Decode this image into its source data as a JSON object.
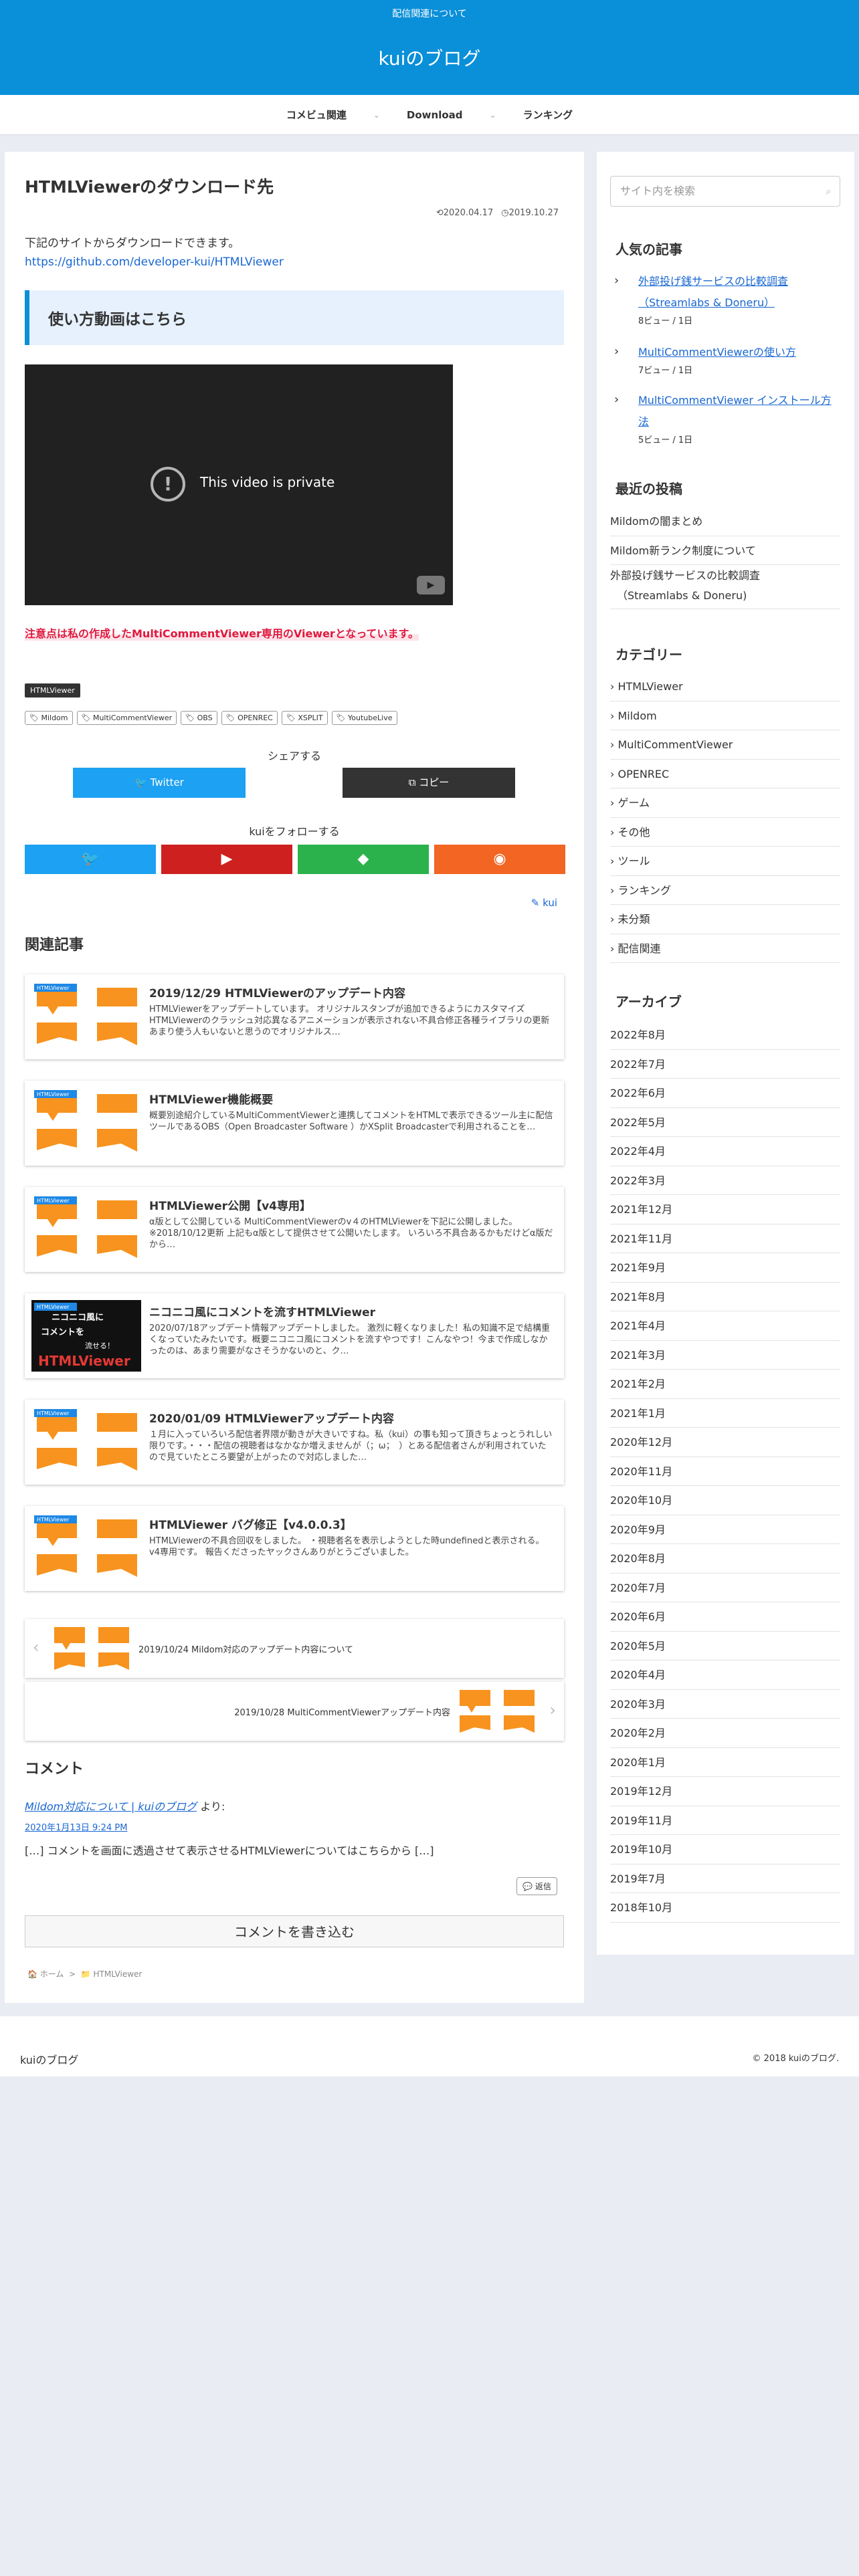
{
  "header": {
    "tagline": "配信関連について",
    "site_title": "kuiのブログ"
  },
  "nav": [
    {
      "label": "コメビュ関連"
    },
    {
      "label": "Download"
    },
    {
      "label": "ランキング"
    }
  ],
  "post": {
    "title": "HTMLViewerのダウンロード先",
    "published": "2020.04.17",
    "updated": "2019.10.27",
    "intro": "下記のサイトからダウンロードできます。",
    "link": "https://github.com/developer-kui/HTMLViewer",
    "h2": "使い方動画はこちら",
    "video_message": "This video is private",
    "note": "注意点は私の作成したMultiCommentViewer専用のViewerとなっています。",
    "category": "HTMLViewer",
    "tags": [
      "Mildom",
      "MultiCommentViewer",
      "OBS",
      "OPENREC",
      "XSPLIT",
      "YoutubeLive"
    ],
    "share_heading": "シェアする",
    "share_twitter": "Twitter",
    "share_copy": "コピー",
    "follow_heading": "kuiをフォローする",
    "author": "kui"
  },
  "related": {
    "heading": "関連記事",
    "items": [
      {
        "badge": "HTMLViewer",
        "title": "2019/12/29 HTMLViewerのアップデート内容",
        "snippet": "HTMLViewerをアップデートしています。 オリジナルスタンプが追加できるようにカスタマイズHTMLViewerのクラッシュ対応異なるアニメーションが表示されない不具合修正各種ライブラリの更新あまり使う人もいないと思うのでオリジナルス…"
      },
      {
        "badge": "HTMLViewer",
        "title": "HTMLViewer機能概要",
        "snippet": "概要別途紹介しているMultiCommentViewerと連携してコメントをHTMLで表示できるツール主に配信ツールであるOBS（Open Broadcaster Software ）かXSplit Broadcasterで利用されることを…"
      },
      {
        "badge": "HTMLViewer",
        "title": "HTMLViewer公開【v4専用】",
        "snippet": "α版として公開している MultiCommentViewerのv４のHTMLViewerを下記に公開しました。 ※2018/10/12更新 上記もα版として提供させて公開いたします。 いろいろ不具合あるかもだけどα版だから…"
      },
      {
        "badge": "HTMLViewer",
        "title": "ニコニコ風にコメントを流すHTMLViewer",
        "snippet": "2020/07/18アップデート情報アップデートしました。 激烈に軽くなりました！私の知識不足で結構重くなっていたみたいです。概要ニコニコ風にコメントを流すやつです！こんなやつ！今まで作成しなかったのは、あまり需要がなさそうかないのと、ク…",
        "thumb_text": [
          "ニコニコ風に",
          "コメントを",
          "流せる！",
          "HTMLViewer"
        ]
      },
      {
        "badge": "HTMLViewer",
        "title": "2020/01/09 HTMLViewerアップデート内容",
        "snippet": "１月に入っていろいろ配信者界隈が動きが大きいですね。私（kui）の事も知って頂きちょっとうれしい限りです。・・・配信の視聴者はなかなか増えませんが（；ω；　）とある配信者さんが利用されていたので見ていたところ要望が上がったので対応しました…"
      },
      {
        "badge": "HTMLViewer",
        "title": "HTMLViewer バグ修正【v4.0.0.3】",
        "snippet": "HTMLViewerの不具合回収をしました。 ・視聴者名を表示しようとした時undefinedと表示される。 v4専用です。 報告くださったヤックさんありがとうございました。"
      }
    ]
  },
  "post_nav": {
    "prev": "2019/10/24 Mildom対応のアップデート内容について",
    "next": "2019/10/28 MultiCommentViewerアップデート内容"
  },
  "comments": {
    "heading": "コメント",
    "author": "Mildom対応について | kuiのブログ",
    "author_suffix": "より:",
    "date": "2020年1月13日 9:24 PM",
    "body": "[…] コメントを画面に透過させて表示させるHTMLViewerについてはこちらから […]",
    "reply": "返信",
    "write": "コメントを書き込む"
  },
  "breadcrumb": {
    "home": "ホーム",
    "category": "HTMLViewer"
  },
  "sidebar": {
    "search_placeholder": "サイト内を検索",
    "popular_heading": "人気の記事",
    "popular": [
      {
        "title": "外部投げ銭サービスの比較調査（Streamlabs & Doneru）",
        "views": "8ビュー / 1日"
      },
      {
        "title": "MultiCommentViewerの使い方",
        "views": "7ビュー / 1日"
      },
      {
        "title": "MultiCommentViewer インストール方法",
        "views": "5ビュー / 1日"
      }
    ],
    "recent_heading": "最近の投稿",
    "recent": [
      "Mildomの闇まとめ",
      "Mildom新ランク制度について",
      "外部投げ銭サービスの比較調査",
      "（Streamlabs & Doneru)"
    ],
    "category_heading": "カテゴリー",
    "categories": [
      "HTMLViewer",
      "Mildom",
      "MultiCommentViewer",
      "OPENREC",
      "ゲーム",
      "その他",
      "ツール",
      "ランキング",
      "未分類",
      "配信関連"
    ],
    "archive_heading": "アーカイブ",
    "archives": [
      "2022年8月",
      "2022年7月",
      "2022年6月",
      "2022年5月",
      "2022年4月",
      "2022年3月",
      "2021年12月",
      "2021年11月",
      "2021年9月",
      "2021年8月",
      "2021年4月",
      "2021年3月",
      "2021年2月",
      "2021年1月",
      "2020年12月",
      "2020年11月",
      "2020年10月",
      "2020年9月",
      "2020年8月",
      "2020年7月",
      "2020年6月",
      "2020年5月",
      "2020年4月",
      "2020年3月",
      "2020年2月",
      "2020年1月",
      "2019年12月",
      "2019年11月",
      "2019年10月",
      "2019年7月",
      "2018年10月"
    ]
  },
  "footer": {
    "site": "kuiのブログ",
    "copyright": "© 2018 kuiのブログ."
  },
  "colors": {
    "header": "#0a8fd9",
    "twitter": "#1da1f2",
    "youtube": "#cd201f",
    "feedly": "#2bb24c",
    "rss": "#f26522",
    "thumb_orange": "#f7931e"
  }
}
